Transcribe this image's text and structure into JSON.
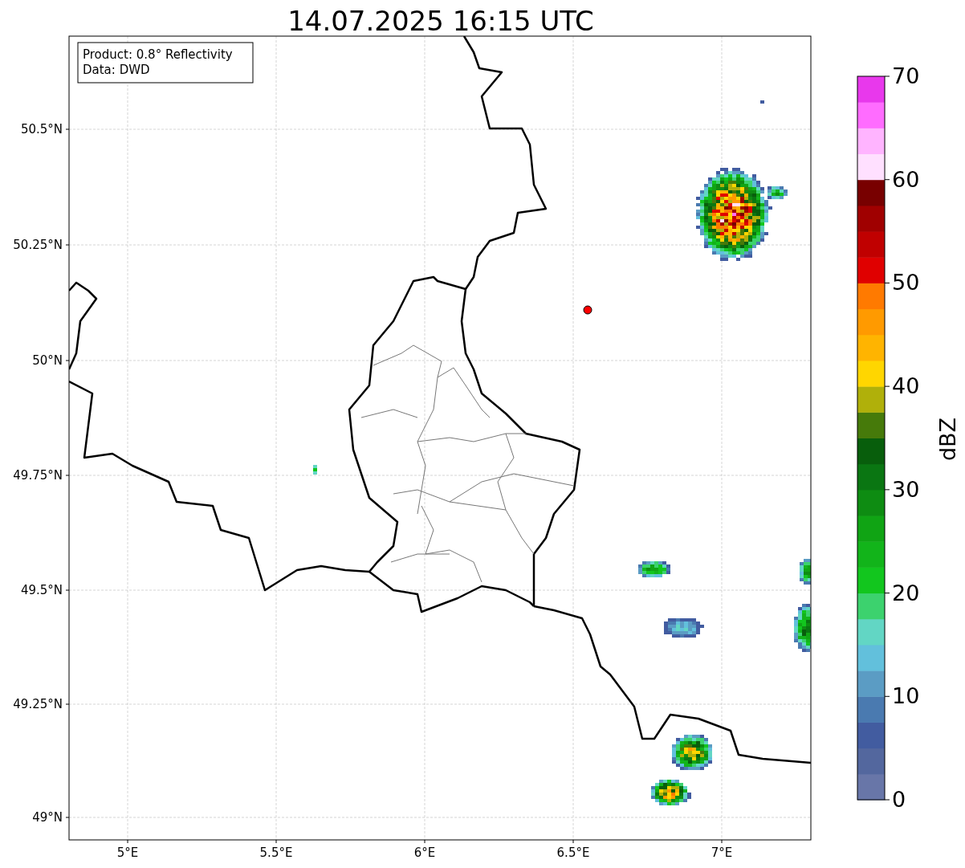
{
  "title": "14.07.2025 16:15 UTC",
  "info_box": [
    "Product: 0.8° Reflectivity",
    "Data: DWD"
  ],
  "map": {
    "x_ticks": [
      "5°E",
      "5.5°E",
      "6°E",
      "6.5°E",
      "7°E"
    ],
    "y_ticks": [
      "50.5°N",
      "50.25°N",
      "50°N",
      "49.75°N",
      "49.5°N",
      "49.25°N",
      "49°N"
    ]
  },
  "colorbar": {
    "label": "dBZ",
    "ticks": [
      "70",
      "60",
      "50",
      "40",
      "30",
      "20",
      "10",
      "0"
    ],
    "bins": [
      {
        "color": "#6876a8"
      },
      {
        "color": "#53679e"
      },
      {
        "color": "#425ca0"
      },
      {
        "color": "#4a7ab0"
      },
      {
        "color": "#5b9cc4"
      },
      {
        "color": "#62c0dc"
      },
      {
        "color": "#62d6c4"
      },
      {
        "color": "#3cd26e"
      },
      {
        "color": "#12c61e"
      },
      {
        "color": "#12b41a"
      },
      {
        "color": "#10a414"
      },
      {
        "color": "#0e8c12"
      },
      {
        "color": "#0a7612"
      },
      {
        "color": "#085e0c"
      },
      {
        "color": "#467a0a"
      },
      {
        "color": "#b0b00a"
      },
      {
        "color": "#ffd600"
      },
      {
        "color": "#ffb400"
      },
      {
        "color": "#ff9a00"
      },
      {
        "color": "#ff7a00"
      },
      {
        "color": "#e00000"
      },
      {
        "color": "#c00000"
      },
      {
        "color": "#a00000"
      },
      {
        "color": "#780000"
      },
      {
        "color": "#ffe0ff"
      },
      {
        "color": "#ffb4ff"
      },
      {
        "color": "#ff6cff"
      },
      {
        "color": "#e838ec"
      }
    ]
  }
}
